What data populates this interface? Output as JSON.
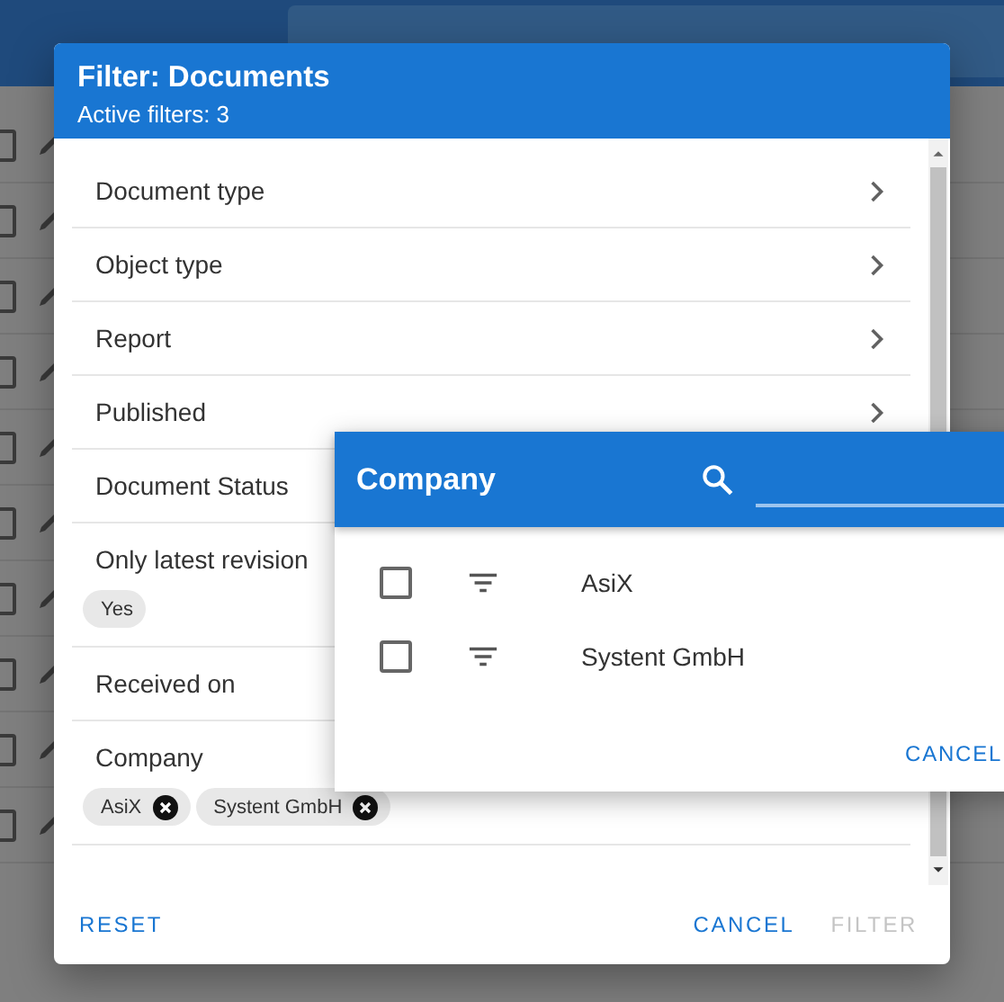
{
  "background_rows": [
    {
      "checked": false
    },
    {
      "checked": false
    },
    {
      "checked": false
    },
    {
      "checked": false
    },
    {
      "checked": false
    },
    {
      "checked": false
    },
    {
      "checked": false
    },
    {
      "checked": false
    },
    {
      "checked": false
    },
    {
      "checked": false
    }
  ],
  "dialog": {
    "title": "Filter: Documents",
    "subtitle": "Active filters: 3",
    "filters": [
      {
        "label": "Document type",
        "chevron": true
      },
      {
        "label": "Object type",
        "chevron": true
      },
      {
        "label": "Report",
        "chevron": true
      },
      {
        "label": "Published",
        "chevron": true
      },
      {
        "label": "Document Status"
      },
      {
        "label": "Only latest revision",
        "chips": [
          {
            "label": "Yes",
            "removable": false
          }
        ]
      },
      {
        "label": "Received on"
      },
      {
        "label": "Company",
        "chips": [
          {
            "label": "AsiX",
            "removable": true
          },
          {
            "label": "Systent GmbH",
            "removable": true
          }
        ]
      }
    ],
    "buttons": [
      {
        "label": "RESET",
        "disabled": false
      },
      {
        "label": "CANCEL",
        "disabled": false
      },
      {
        "label": "FILTER",
        "disabled": true
      }
    ]
  },
  "company_popup": {
    "title": "Company",
    "options": [
      {
        "label": "AsiX",
        "checked": false
      },
      {
        "label": "Systent GmbH",
        "checked": false
      }
    ],
    "buttons": [
      {
        "label": "CANCEL",
        "disabled": false
      }
    ]
  }
}
